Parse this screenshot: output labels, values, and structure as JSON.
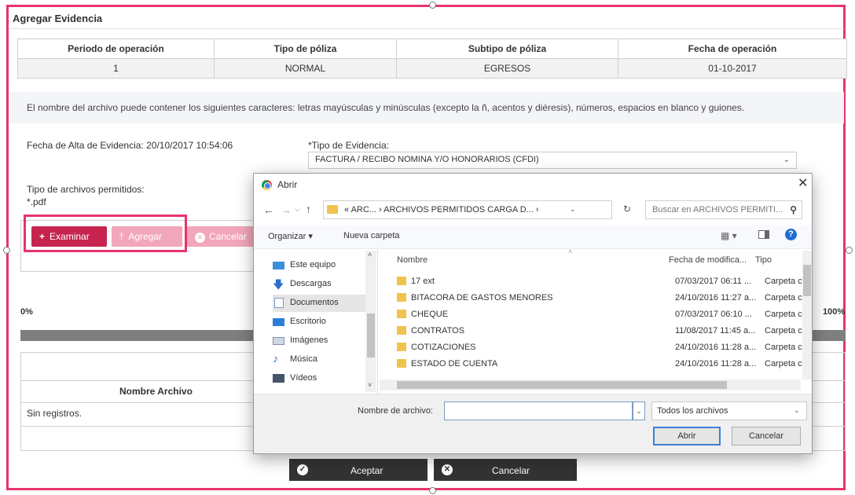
{
  "panel": {
    "title": "Agregar Evidencia",
    "table_headers": [
      "Periodo de operación",
      "Tipo de póliza",
      "Subtipo de póliza",
      "Fecha de operación"
    ],
    "table_row": [
      "1",
      "NORMAL",
      "EGRESOS",
      "01-10-2017"
    ],
    "info": "El nombre del archivo puede contener los siguientes caracteres: letras mayúsculas y minúsculas (excepto la ñ, acentos y diéresis), números, espacios en blanco y guiones.",
    "fecha_alta": "Fecha de Alta de Evidencia: 20/10/2017 10:54:06",
    "tipo_evidencia_label": "*Tipo de Evidencia:",
    "tipo_evidencia_value": "FACTURA / RECIBO NOMINA Y/O HONORARIOS (CFDI)",
    "permitidos_label": "Tipo de archivos permitidos:",
    "permitidos_value": "*.pdf",
    "btn_examinar": "Examinar",
    "btn_agregar": "Agregar",
    "btn_cancelar": "Cancelar",
    "progress_start": "0%",
    "progress_end": "100%",
    "files_col": "Nombre Archivo",
    "files_empty": "Sin registros.",
    "btn_aceptar": "Aceptar",
    "btn_cancelar_main": "Cancelar"
  },
  "dialog": {
    "title": "Abrir",
    "address": "« ARC... › ARCHIVOS PERMITIDOS CARGA D... ›",
    "search_placeholder": "Buscar en ARCHIVOS PERMITI...",
    "organizar": "Organizar ▾",
    "nueva_carpeta": "Nueva carpeta",
    "nav": [
      "Este equipo",
      "Descargas",
      "Documentos",
      "Escritorio",
      "Imágenes",
      "Música",
      "Vídeos"
    ],
    "columns": [
      "Nombre",
      "Fecha de modifica...",
      "Tipo"
    ],
    "files": [
      {
        "name": "17 ext",
        "date": "07/03/2017 06:11 ...",
        "type": "Carpeta c"
      },
      {
        "name": "BITACORA DE GASTOS MENORES",
        "date": "24/10/2016 11:27 a...",
        "type": "Carpeta c"
      },
      {
        "name": "CHEQUE",
        "date": "07/03/2017 06:10 ...",
        "type": "Carpeta c"
      },
      {
        "name": "CONTRATOS",
        "date": "11/08/2017 11:45 a...",
        "type": "Carpeta c"
      },
      {
        "name": "COTIZACIONES",
        "date": "24/10/2016 11:28 a...",
        "type": "Carpeta c"
      },
      {
        "name": "ESTADO DE CUENTA",
        "date": "24/10/2016 11:28 a...",
        "type": "Carpeta c"
      }
    ],
    "filename_label": "Nombre de archivo:",
    "filter": "Todos los archivos",
    "btn_abrir": "Abrir",
    "btn_cancelar": "Cancelar"
  },
  "colors": {
    "highlight": "#e8336d",
    "primary": "#c7234f",
    "primary_light": "#f2a6bb",
    "dark": "#333333"
  }
}
